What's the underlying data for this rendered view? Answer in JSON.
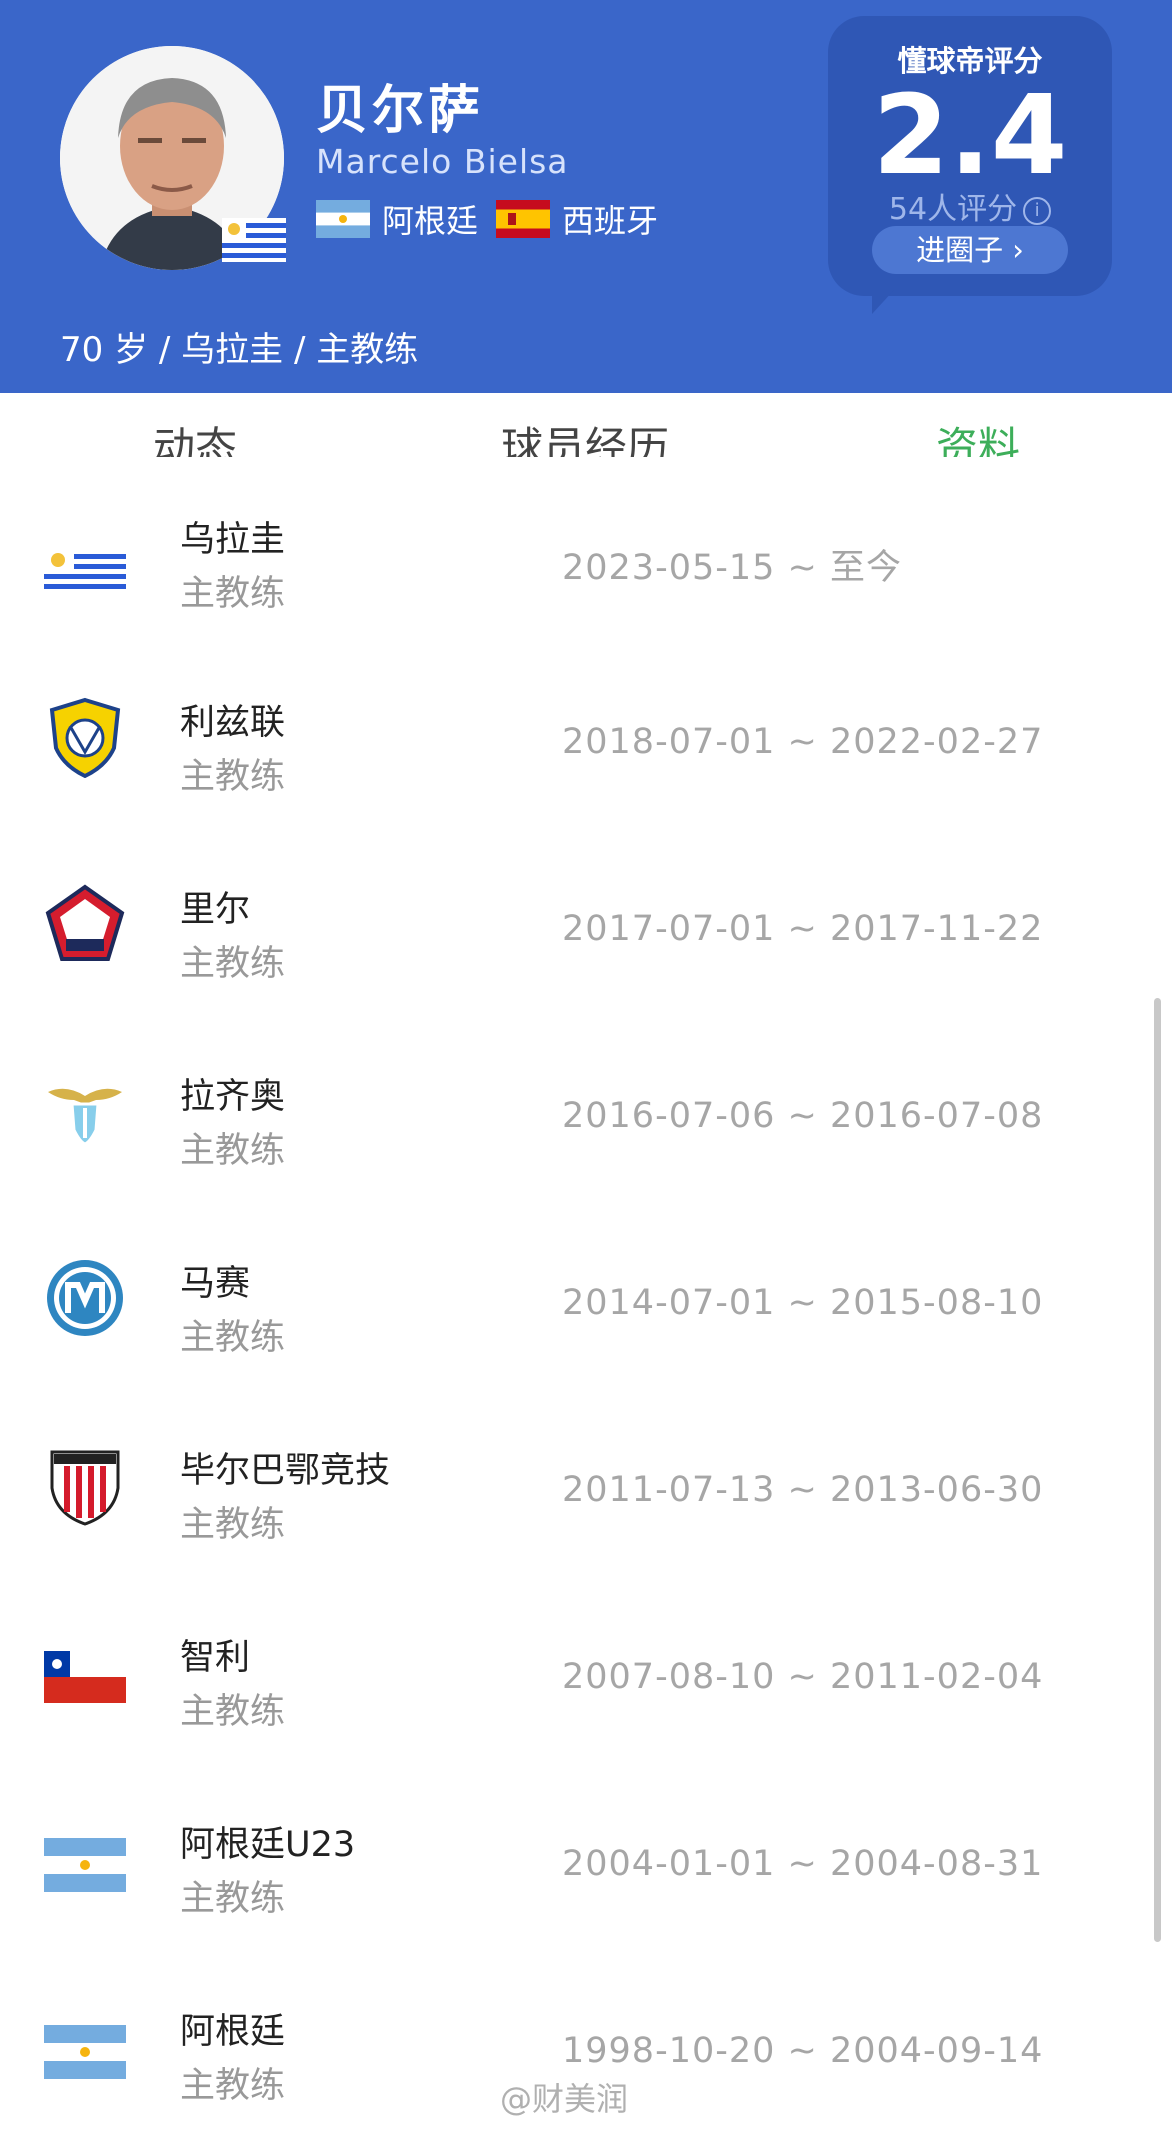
{
  "profile": {
    "name_cn": "贝尔萨",
    "name_en": "Marcelo Bielsa",
    "nationalities": [
      "阿根廷",
      "西班牙"
    ],
    "meta": "70 岁 / 乌拉圭 / 主教练"
  },
  "rating": {
    "title": "懂球帝评分",
    "score": "2.4",
    "count": "54人评分",
    "info_icon": "i",
    "enter_button": "进圈子 ›"
  },
  "tabs": [
    "动态",
    "球员经历",
    "资料"
  ],
  "active_tab": "资料",
  "career": [
    {
      "team": "乌拉圭",
      "role": "主教练",
      "dates": "2023-05-15 ~ 至今",
      "logo": "uruguay-flag"
    },
    {
      "team": "利兹联",
      "role": "主教练",
      "dates": "2018-07-01 ~ 2022-02-27",
      "logo": "leeds-crest"
    },
    {
      "team": "里尔",
      "role": "主教练",
      "dates": "2017-07-01 ~ 2017-11-22",
      "logo": "lille-crest"
    },
    {
      "team": "拉齐奥",
      "role": "主教练",
      "dates": "2016-07-06 ~ 2016-07-08",
      "logo": "lazio-crest"
    },
    {
      "team": "马赛",
      "role": "主教练",
      "dates": "2014-07-01 ~ 2015-08-10",
      "logo": "marseille-crest"
    },
    {
      "team": "毕尔巴鄂竞技",
      "role": "主教练",
      "dates": "2011-07-13 ~ 2013-06-30",
      "logo": "athletic-bilbao-crest"
    },
    {
      "team": "智利",
      "role": "主教练",
      "dates": "2007-08-10 ~ 2011-02-04",
      "logo": "chile-flag"
    },
    {
      "team": "阿根廷U23",
      "role": "主教练",
      "dates": "2004-01-01 ~ 2004-08-31",
      "logo": "argentina-flag"
    },
    {
      "team": "阿根廷",
      "role": "主教练",
      "dates": "1998-10-20 ~ 2004-09-14",
      "logo": "argentina-flag"
    }
  ],
  "watermark": "@财美润",
  "colors": {
    "header": "#3a66c9",
    "active_tab": "#3dae5a"
  }
}
